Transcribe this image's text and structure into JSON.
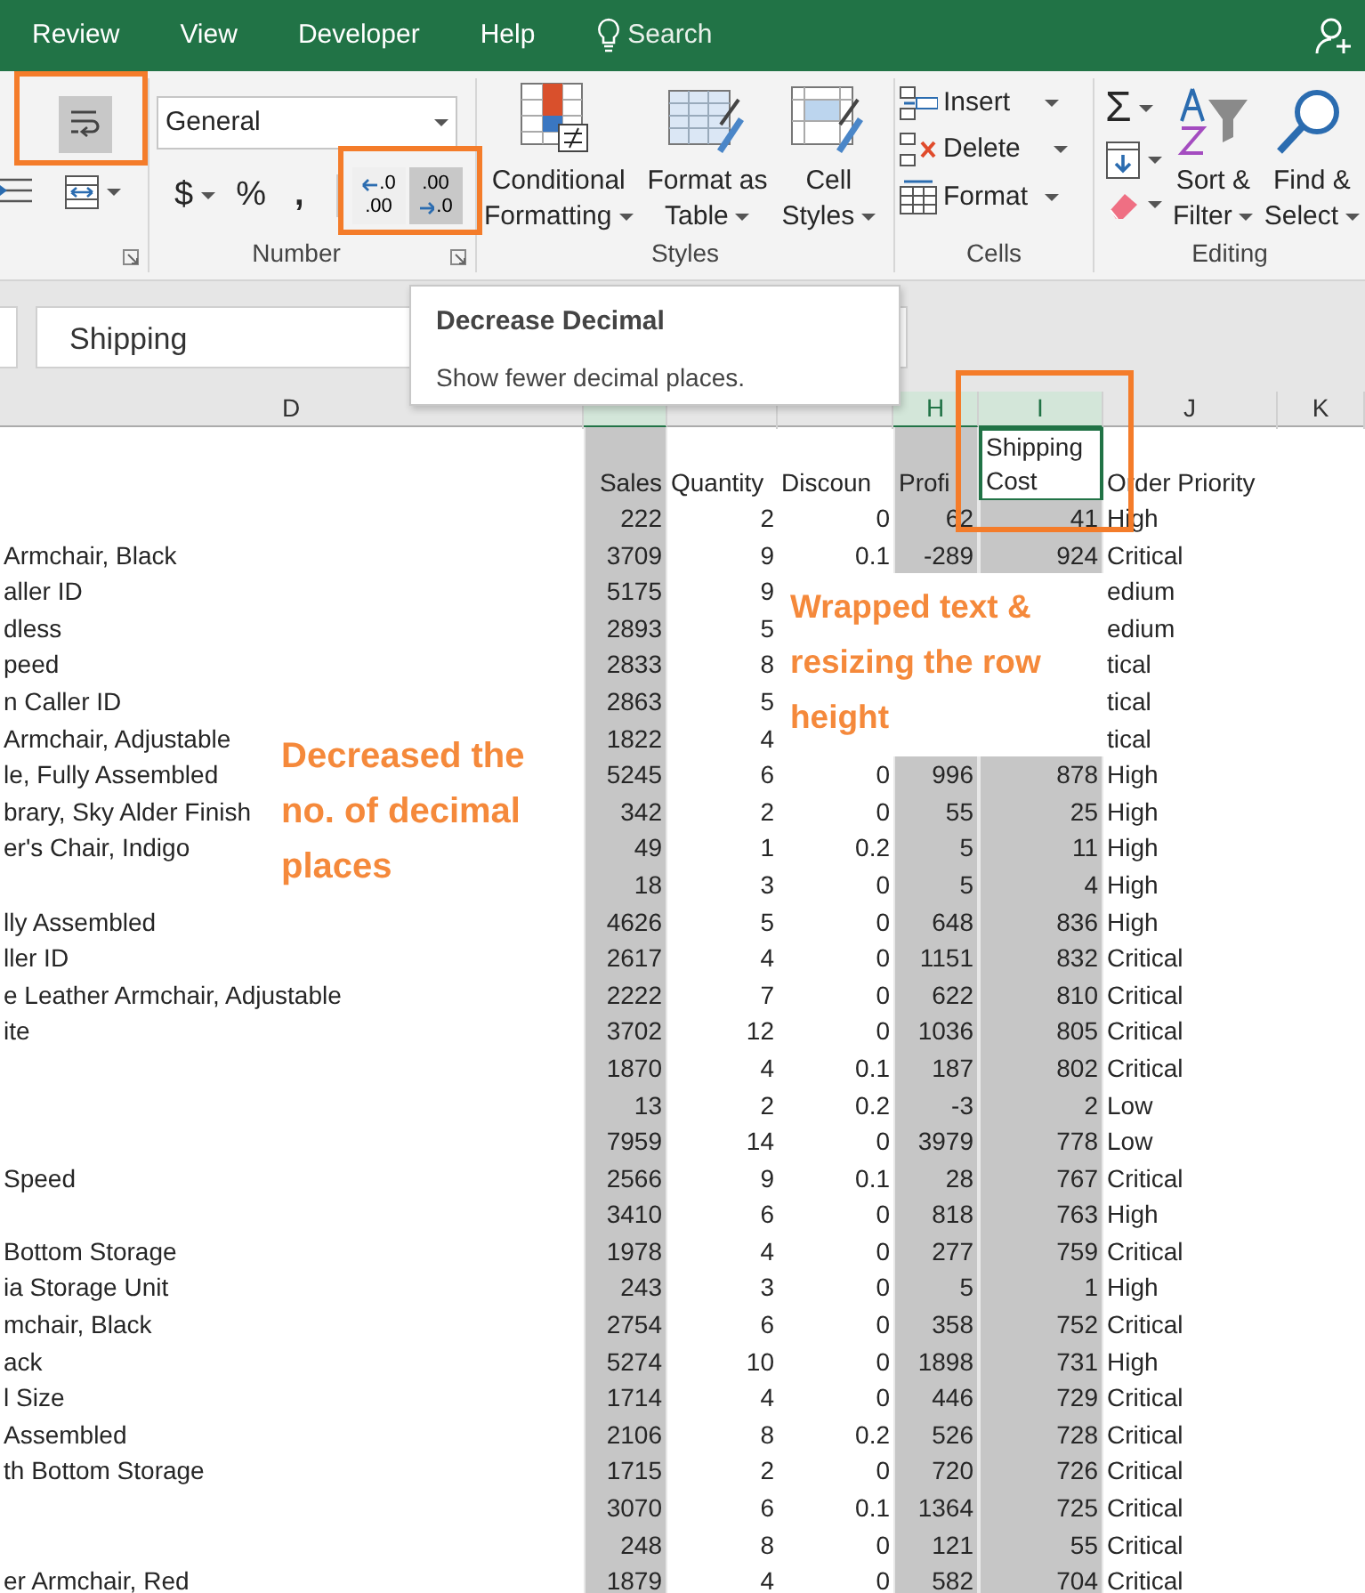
{
  "tabs": [
    {
      "label": "Review"
    },
    {
      "label": "View"
    },
    {
      "label": "Developer"
    },
    {
      "label": "Help"
    }
  ],
  "search": {
    "label": "Search"
  },
  "ribbon": {
    "alignment": {
      "wrap_pressed": true,
      "wrap_outlined": true
    },
    "number": {
      "format": "General",
      "currency": "$",
      "percent": "%",
      "comma": ",",
      "label": "Number",
      "decimals_outlined": true,
      "decimal_buttons": [
        {
          "kind": "increase",
          "top": ".0",
          "bottom": ".00",
          "pressed": false
        },
        {
          "kind": "decrease",
          "top": ".00",
          "bottom": ".0",
          "pressed": true
        }
      ]
    },
    "styles": {
      "label": "Styles",
      "buttons": [
        {
          "kind": "conditional",
          "lines": [
            "Conditional",
            "Formatting"
          ]
        },
        {
          "kind": "table",
          "lines": [
            "Format as",
            "Table"
          ]
        },
        {
          "kind": "cellstyles",
          "lines": [
            "Cell",
            "Styles"
          ]
        }
      ]
    },
    "cells": {
      "label": "Cells",
      "buttons": [
        {
          "kind": "insert",
          "label": "Insert"
        },
        {
          "kind": "delete",
          "label": "Delete"
        },
        {
          "kind": "format",
          "label": "Format"
        }
      ]
    },
    "editing": {
      "label": "Editing",
      "sum": "Σ",
      "buttons": [
        {
          "kind": "sort",
          "lines": [
            "Sort &",
            "Filter"
          ]
        },
        {
          "kind": "find",
          "lines": [
            "Find &",
            "Select"
          ]
        }
      ]
    }
  },
  "formula_bar": {
    "value": "Shipping"
  },
  "tooltip": {
    "title": "Decrease Decimal",
    "text": "Show fewer decimal places."
  },
  "sheet": {
    "columns": [
      {
        "letter": "D",
        "selected": false
      },
      {
        "selected": true
      },
      {
        "selected": false
      },
      {
        "selected": false
      },
      {
        "letter": "H",
        "selected": true
      },
      {
        "letter": "I",
        "selected": true,
        "outlined": true
      },
      {
        "letter": "J",
        "selected": false
      },
      {
        "letter": "K",
        "selected": false
      }
    ],
    "header_row": [
      {
        "active": false
      },
      {
        "text": "Sales",
        "active": false
      },
      {
        "text": "Quantity",
        "active": false
      },
      {
        "text": "Discoun",
        "active": false
      },
      {
        "text": "Profi",
        "active": false
      },
      {
        "text": "Shipping Cost",
        "active": true
      },
      {
        "text": "Order Priority",
        "active": false
      }
    ],
    "rows": [
      {
        "sales": "222",
        "quantity": "2",
        "discount": "0",
        "profit": "62",
        "shipping": "41",
        "priority": "High"
      },
      {
        "product": "Armchair, Black",
        "sales": "3709",
        "quantity": "9",
        "discount": "0.1",
        "profit": "-289",
        "shipping": "924",
        "priority": "Critical"
      },
      {
        "product": "aller ID",
        "sales": "5175",
        "quantity": "9",
        "priority": "edium"
      },
      {
        "product": "dless",
        "sales": "2893",
        "quantity": "5",
        "priority": "edium"
      },
      {
        "product": "peed",
        "sales": "2833",
        "quantity": "8",
        "priority": "tical"
      },
      {
        "product": "n Caller ID",
        "sales": "2863",
        "quantity": "5",
        "priority": "tical"
      },
      {
        "product": "Armchair, Adjustable",
        "sales": "1822",
        "quantity": "4",
        "priority": "tical"
      },
      {
        "product": "le, Fully Assembled",
        "sales": "5245",
        "quantity": "6",
        "discount": "0",
        "profit": "996",
        "shipping": "878",
        "priority": "High"
      },
      {
        "product": "brary, Sky Alder Finish",
        "sales": "342",
        "quantity": "2",
        "discount": "0",
        "profit": "55",
        "shipping": "25",
        "priority": "High"
      },
      {
        "product": "er's Chair, Indigo",
        "sales": "49",
        "quantity": "1",
        "discount": "0.2",
        "profit": "5",
        "shipping": "11",
        "priority": "High"
      },
      {
        "sales": "18",
        "quantity": "3",
        "discount": "0",
        "profit": "5",
        "shipping": "4",
        "priority": "High"
      },
      {
        "product": "lly Assembled",
        "sales": "4626",
        "quantity": "5",
        "discount": "0",
        "profit": "648",
        "shipping": "836",
        "priority": "High"
      },
      {
        "product": "ller ID",
        "sales": "2617",
        "quantity": "4",
        "discount": "0",
        "profit": "1151",
        "shipping": "832",
        "priority": "Critical"
      },
      {
        "product": "e Leather Armchair, Adjustable",
        "sales": "2222",
        "quantity": "7",
        "discount": "0",
        "profit": "622",
        "shipping": "810",
        "priority": "Critical"
      },
      {
        "product": "ite",
        "sales": "3702",
        "quantity": "12",
        "discount": "0",
        "profit": "1036",
        "shipping": "805",
        "priority": "Critical"
      },
      {
        "sales": "1870",
        "quantity": "4",
        "discount": "0.1",
        "profit": "187",
        "shipping": "802",
        "priority": "Critical"
      },
      {
        "sales": "13",
        "quantity": "2",
        "discount": "0.2",
        "profit": "-3",
        "shipping": "2",
        "priority": "Low"
      },
      {
        "sales": "7959",
        "quantity": "14",
        "discount": "0",
        "profit": "3979",
        "shipping": "778",
        "priority": "Low"
      },
      {
        "product": "Speed",
        "sales": "2566",
        "quantity": "9",
        "discount": "0.1",
        "profit": "28",
        "shipping": "767",
        "priority": "Critical"
      },
      {
        "sales": "3410",
        "quantity": "6",
        "discount": "0",
        "profit": "818",
        "shipping": "763",
        "priority": "High"
      },
      {
        "product": "Bottom Storage",
        "sales": "1978",
        "quantity": "4",
        "discount": "0",
        "profit": "277",
        "shipping": "759",
        "priority": "Critical"
      },
      {
        "product": "ia Storage Unit",
        "sales": "243",
        "quantity": "3",
        "discount": "0",
        "profit": "5",
        "shipping": "1",
        "priority": "High"
      },
      {
        "product": "mchair, Black",
        "sales": "2754",
        "quantity": "6",
        "discount": "0",
        "profit": "358",
        "shipping": "752",
        "priority": "Critical"
      },
      {
        "product": "ack",
        "sales": "5274",
        "quantity": "10",
        "discount": "0",
        "profit": "1898",
        "shipping": "731",
        "priority": "High"
      },
      {
        "product": "l Size",
        "sales": "1714",
        "quantity": "4",
        "discount": "0",
        "profit": "446",
        "shipping": "729",
        "priority": "Critical"
      },
      {
        "product": "Assembled",
        "sales": "2106",
        "quantity": "8",
        "discount": "0.2",
        "profit": "526",
        "shipping": "728",
        "priority": "Critical"
      },
      {
        "product": "th Bottom Storage",
        "sales": "1715",
        "quantity": "2",
        "discount": "0",
        "profit": "720",
        "shipping": "726",
        "priority": "Critical"
      },
      {
        "sales": "3070",
        "quantity": "6",
        "discount": "0.1",
        "profit": "1364",
        "shipping": "725",
        "priority": "Critical"
      },
      {
        "sales": "248",
        "quantity": "8",
        "discount": "0",
        "profit": "121",
        "shipping": "55",
        "priority": "Critical"
      },
      {
        "product": "er Armchair, Red",
        "sales": "1879",
        "quantity": "4",
        "discount": "0",
        "profit": "582",
        "shipping": "704",
        "priority": "Critical"
      }
    ]
  },
  "annotations": [
    {
      "kind": "decimals",
      "text": "Decreased the no. of decimal places"
    },
    {
      "kind": "wrap",
      "text": "Wrapped text & resizing the row height"
    }
  ]
}
